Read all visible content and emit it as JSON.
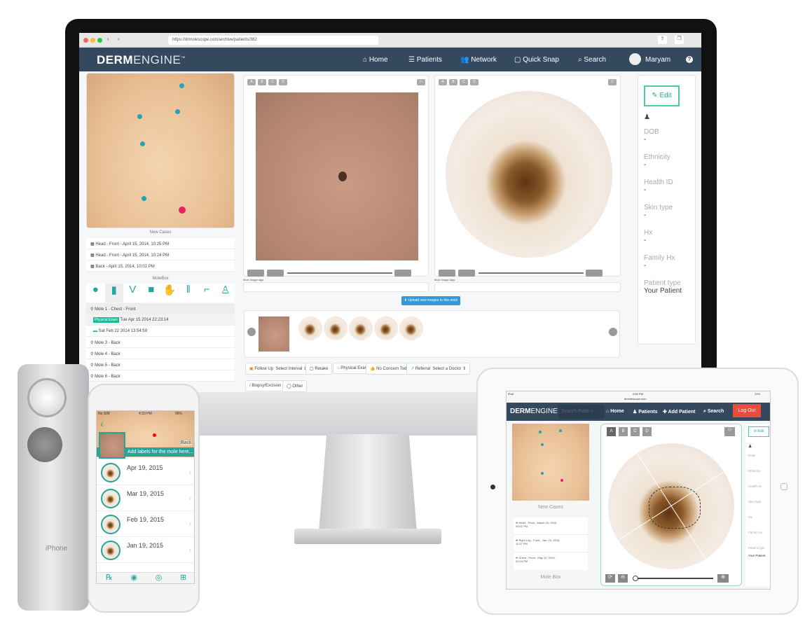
{
  "browser": {
    "url": "https://drmolescope.com/archive/patients/382"
  },
  "desktop": {
    "logo": {
      "bold": "DERM",
      "light": "ENGINE",
      "tm": "™"
    },
    "nav": [
      {
        "label": "Home",
        "icon": "home-icon"
      },
      {
        "label": "Patients",
        "icon": "list-icon"
      },
      {
        "label": "Network",
        "icon": "users-icon"
      },
      {
        "label": "Quick Snap",
        "icon": "camera-icon"
      },
      {
        "label": "Search",
        "icon": "search-icon"
      }
    ],
    "user": "Maryam",
    "help": "?",
    "new_cases_title": "New Cases",
    "new_cases": [
      "Head - Front - April 15, 2014, 10:25 PM",
      "Head - Front - April 15, 2014, 10:24 PM",
      "Back - April 15, 2014, 10:02 PM"
    ],
    "molebox_title": "MoleBox",
    "moles": {
      "selected": "Mole 1 - Chest - Front",
      "entries": [
        {
          "badge": "Physical Exam",
          "date": "Tue Apr 15 2014 22:23:14"
        },
        {
          "badge": "",
          "date": "Sat Feb 22 2014 13:54:59"
        }
      ],
      "others": [
        "Mole 3 - Back",
        "Mole 4 - Back",
        "Mole 5 - Back",
        "Mole 6 - Back"
      ]
    },
    "view_tabs": [
      "A",
      "B",
      "C",
      "D"
    ],
    "tags_label": "Mole image tags",
    "upload_label": "Upload new images to this mole",
    "actions": [
      {
        "label": "Follow Up",
        "select": "Select Interval"
      },
      {
        "label": "Retake"
      },
      {
        "label": "Physical Exam"
      },
      {
        "label": "No Concern Today"
      },
      {
        "label": "Referral",
        "select": "Select a Doctor"
      },
      {
        "label": "Biopsy/Excision"
      },
      {
        "label": "Other"
      }
    ],
    "patient": {
      "edit": "Edit",
      "fields": [
        {
          "label": "DOB",
          "value": "-"
        },
        {
          "label": "Ethnicity",
          "value": "-"
        },
        {
          "label": "Health ID",
          "value": "-"
        },
        {
          "label": "Skin type",
          "value": "-"
        },
        {
          "label": "Hx",
          "value": "-"
        },
        {
          "label": "Family Hx",
          "value": "-"
        },
        {
          "label": "Patient type",
          "value": "Your Patient"
        }
      ]
    }
  },
  "phone": {
    "carrier": "No SIM",
    "time": "4:33 PM",
    "battery": "96%",
    "back": "Back",
    "banner": "Add labels for the mole here...",
    "dates": [
      "Apr 19, 2015",
      "Mar 19, 2015",
      "Feb 19, 2015",
      "Jan 19, 2015"
    ],
    "device_label": "iPhone"
  },
  "tablet": {
    "carrier": "iPad",
    "time": "4:54 PM",
    "battery": "22%",
    "url": "drmolescope.com",
    "search_placeholder": "Search Patie",
    "nav": [
      "Home",
      "Patients",
      "Add Patient",
      "Search"
    ],
    "logout": "Log Out",
    "new_cases_title": "New Cases",
    "new_cases": [
      {
        "l1": "Head - Front - March 19, 2015,",
        "l2": "06:01 PM"
      },
      {
        "l1": "Right Leg - Front - Jan. 19, 2015,",
        "l2": "11:37 PM"
      },
      {
        "l1": "Chest - Front - May 10, 2015,",
        "l2": "02:24 PM"
      }
    ],
    "molebox_title": "Mole Box",
    "edit": "Edit",
    "fields": [
      {
        "label": "DOB",
        "value": "-"
      },
      {
        "label": "Ethnicity",
        "value": "-"
      },
      {
        "label": "Health ID",
        "value": "-"
      },
      {
        "label": "Skin type",
        "value": "-"
      },
      {
        "label": "Hx",
        "value": "-"
      },
      {
        "label": "Family Hx",
        "value": "-"
      },
      {
        "label": "Patient type",
        "value": "Your Patient"
      }
    ]
  },
  "colors": {
    "nav": "#34495e",
    "accent": "#26a69a",
    "upload": "#3498db",
    "logout": "#e74c3c",
    "pin": "#26a1b8",
    "pin_active": "#e91e63"
  }
}
